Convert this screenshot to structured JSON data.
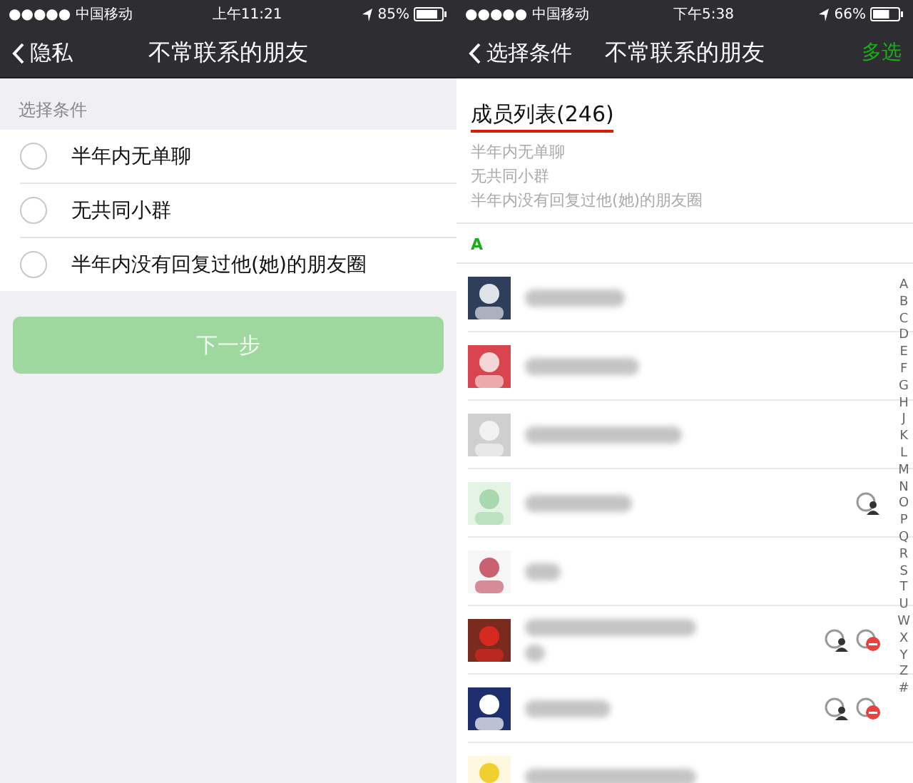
{
  "left": {
    "status_bar": {
      "carrier": "●●●●● 中国移动",
      "time": "上午11:21",
      "battery": "85%"
    },
    "nav": {
      "back": "隐私",
      "title": "不常联系的朋友"
    },
    "section_label": "选择条件",
    "options": [
      {
        "label": "半年内无单聊",
        "checked": false
      },
      {
        "label": "无共同小群",
        "checked": false
      },
      {
        "label": "半年内没有回复过他(她)的朋友圈",
        "checked": false
      }
    ],
    "next_button": {
      "label": "下一步",
      "disabled": true
    }
  },
  "right": {
    "status_bar": {
      "carrier": "●●●●● 中国移动",
      "time": "下午5:38",
      "battery": "66%"
    },
    "nav": {
      "back": "选择条件",
      "title": "不常联系的朋友",
      "action": "多选"
    },
    "member_title": "成员列表(246)",
    "criteria": [
      "半年内无单聊",
      "无共同小群",
      "半年内没有回复过他(她)的朋友圈"
    ],
    "section": "A",
    "contacts": [
      {
        "kind": "picture",
        "person_badge": false,
        "minus_badge": false,
        "two_lines": false
      },
      {
        "kind": "picture",
        "person_badge": false,
        "minus_badge": false,
        "two_lines": false
      },
      {
        "kind": "picture",
        "person_badge": false,
        "minus_badge": false,
        "two_lines": false
      },
      {
        "kind": "picture",
        "person_badge": true,
        "minus_badge": false,
        "two_lines": false
      },
      {
        "kind": "picture",
        "person_badge": false,
        "minus_badge": false,
        "two_lines": false
      },
      {
        "kind": "picture",
        "person_badge": true,
        "minus_badge": true,
        "two_lines": true
      },
      {
        "kind": "picture",
        "person_badge": true,
        "minus_badge": true,
        "two_lines": false
      },
      {
        "kind": "picture",
        "person_badge": false,
        "minus_badge": false,
        "two_lines": false
      }
    ],
    "index": [
      "A",
      "B",
      "C",
      "D",
      "E",
      "F",
      "G",
      "H",
      "J",
      "K",
      "L",
      "M",
      "N",
      "O",
      "P",
      "Q",
      "R",
      "S",
      "T",
      "U",
      "W",
      "X",
      "Y",
      "Z",
      "#"
    ]
  }
}
